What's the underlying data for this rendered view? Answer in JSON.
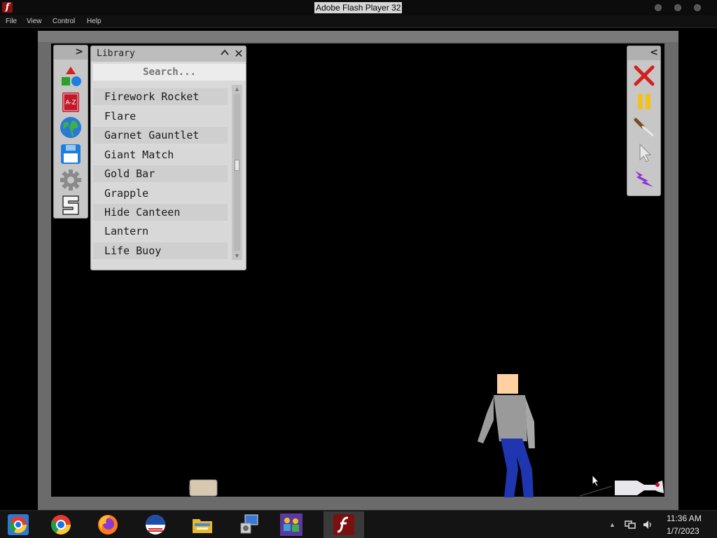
{
  "window": {
    "title": "Adobe Flash Player 32",
    "app_icon_glyph": "f"
  },
  "menu": {
    "items": [
      "File",
      "View",
      "Control",
      "Help"
    ]
  },
  "library": {
    "title": "Library",
    "collapse_glyph": "^",
    "close_glyph": "✕",
    "search_placeholder": "Search...",
    "partial_top_item": "' '",
    "items": [
      "Firework Rocket",
      "Flare",
      "Garnet Gauntlet",
      "Giant Match",
      "Gold Bar",
      "Grapple",
      "Hide Canteen",
      "Lantern",
      "Life Buoy"
    ],
    "scroll_position": 0.45
  },
  "left_toolbar": {
    "collapse_glyph": ">",
    "tools": [
      {
        "name": "shapes-icon",
        "label": ""
      },
      {
        "name": "library-book-icon",
        "label": "A-Z"
      },
      {
        "name": "globe-icon",
        "label": ""
      },
      {
        "name": "save-disk-icon",
        "label": ""
      },
      {
        "name": "settings-gear-icon",
        "label": ""
      },
      {
        "name": "s-logo-icon",
        "label": ""
      }
    ]
  },
  "right_toolbar": {
    "collapse_glyph": "<",
    "tools": [
      "delete-x-icon",
      "pause-icon",
      "knife-icon",
      "pointer-icon",
      "lightning-icon"
    ]
  },
  "taskbar": {
    "apps": [
      "chrome-icon",
      "chrome-icon",
      "firefox-icon",
      "obama-logo-icon",
      "file-explorer-icon",
      "control-panel-icon",
      "network-users-icon",
      "flash-player-icon"
    ],
    "active_app": "flash-player-icon",
    "tray_arrow": "▲",
    "time": "11:36 AM",
    "date": "1/7/2023"
  },
  "colors": {
    "accent_red": "#c8102e",
    "pause_yellow": "#f2c21b",
    "lightning_purple": "#8a35d6",
    "ragdoll_skin": "#ffd0a0",
    "ragdoll_shirt": "#9a9a9a",
    "ragdoll_pants": "#1f36b0"
  }
}
